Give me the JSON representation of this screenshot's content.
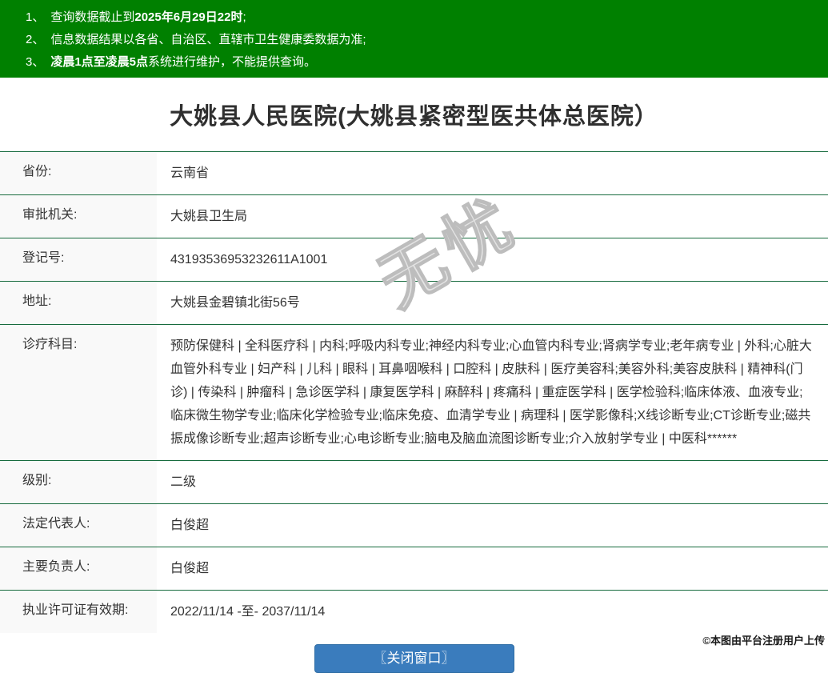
{
  "notice": {
    "items": [
      {
        "num": "1、",
        "pre": "查询数据截止到",
        "bold": "2025年6月29日22时",
        "post": ";"
      },
      {
        "num": "2、",
        "pre": "信息数据结果以各省、自治区、直辖市卫生健康委数据为准;",
        "bold": "",
        "post": ""
      },
      {
        "num": "3、",
        "pre": "",
        "bold": "凌晨1点至凌晨5点",
        "post": "系统进行维护，不能提供查询。"
      }
    ]
  },
  "title": "大姚县人民医院(大姚县紧密型医共体总医院）",
  "table": {
    "rows": [
      {
        "label": "省份:",
        "value": "云南省"
      },
      {
        "label": "审批机关:",
        "value": "大姚县卫生局"
      },
      {
        "label": "登记号:",
        "value": "43193536953232611A1001"
      },
      {
        "label": "地址:",
        "value": "大姚县金碧镇北街56号"
      },
      {
        "label": "诊疗科目:",
        "value": "预防保健科 | 全科医疗科 | 内科;呼吸内科专业;神经内科专业;心血管内科专业;肾病学专业;老年病专业 | 外科;心脏大血管外科专业 | 妇产科 | 儿科 | 眼科 | 耳鼻咽喉科 | 口腔科 | 皮肤科 | 医疗美容科;美容外科;美容皮肤科 | 精神科(门诊) | 传染科 | 肿瘤科 | 急诊医学科 | 康复医学科 | 麻醉科 | 疼痛科 | 重症医学科 | 医学检验科;临床体液、血液专业;临床微生物学专业;临床化学检验专业;临床免疫、血清学专业 | 病理科 | 医学影像科;X线诊断专业;CT诊断专业;磁共振成像诊断专业;超声诊断专业;心电诊断专业;脑电及脑血流图诊断专业;介入放射学专业 | 中医科******"
      },
      {
        "label": "级别:",
        "value": "二级"
      },
      {
        "label": "法定代表人:",
        "value": "白俊超"
      },
      {
        "label": "主要负责人:",
        "value": "白俊超"
      },
      {
        "label": "执业许可证有效期:",
        "value": "2022/11/14 -至- 2037/11/14"
      }
    ]
  },
  "button": {
    "close_label": "〖关闭窗口〗"
  },
  "watermark_text": "无忧",
  "credit": "©本图由平台注册用户上传",
  "colors": {
    "header_green": "#008000",
    "row_line_green": "#176b3e",
    "label_column_bg": "#f9f9f9",
    "button_blue": "#3a7cbd",
    "body_text": "#333333"
  }
}
